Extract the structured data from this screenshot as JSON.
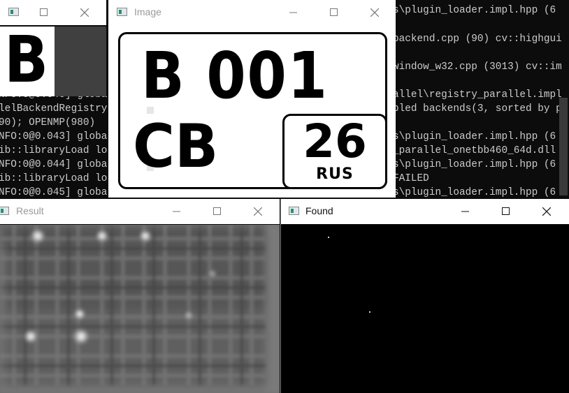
{
  "console": {
    "lines": [
      "s\\plugin_loader.impl.hpp (6",
      "backend.cpp (90) cv::highgui",
      "window_w32.cpp (3013) cv::im",
      "NFO:0@0.043] global",
      "allel\\registry_parallel.impl",
      "lelBackendRegistry",
      "bled backends(3, sorted by p",
      "NFO:0@0.043] global",
      "s\\plugin_loader.impl.hpp (6",
      "ib::libraryLoad lo",
      "_parallel_onetbb460_64d.dll",
      "NFO:0@0.044] globa",
      "s\\plugin_loader.impl.hpp (6",
      "ib::libraryLoad lo",
      "FAILED",
      "NFO:0@0.045] globa",
      "s\\plugin_loader.impl.hpp (6",
      "90); OPENMP(980)"
    ]
  },
  "windows": {
    "b_window": {
      "title": "",
      "glyph": "B"
    },
    "image": {
      "title": "Image",
      "plate": {
        "main": "B 001",
        "series": "CB",
        "region": "26",
        "country": "RUS"
      }
    },
    "result": {
      "title": "Result"
    },
    "found": {
      "title": "Found"
    }
  },
  "colors": {
    "console_bg": "#0c0c0c",
    "console_text": "#cccccc",
    "titlebar_bg": "#ffffff",
    "found_bg": "#000000"
  },
  "icons": {
    "minimize": "minimize-icon",
    "maximize": "maximize-icon",
    "close": "close-icon",
    "app": "opencv-window-icon"
  }
}
